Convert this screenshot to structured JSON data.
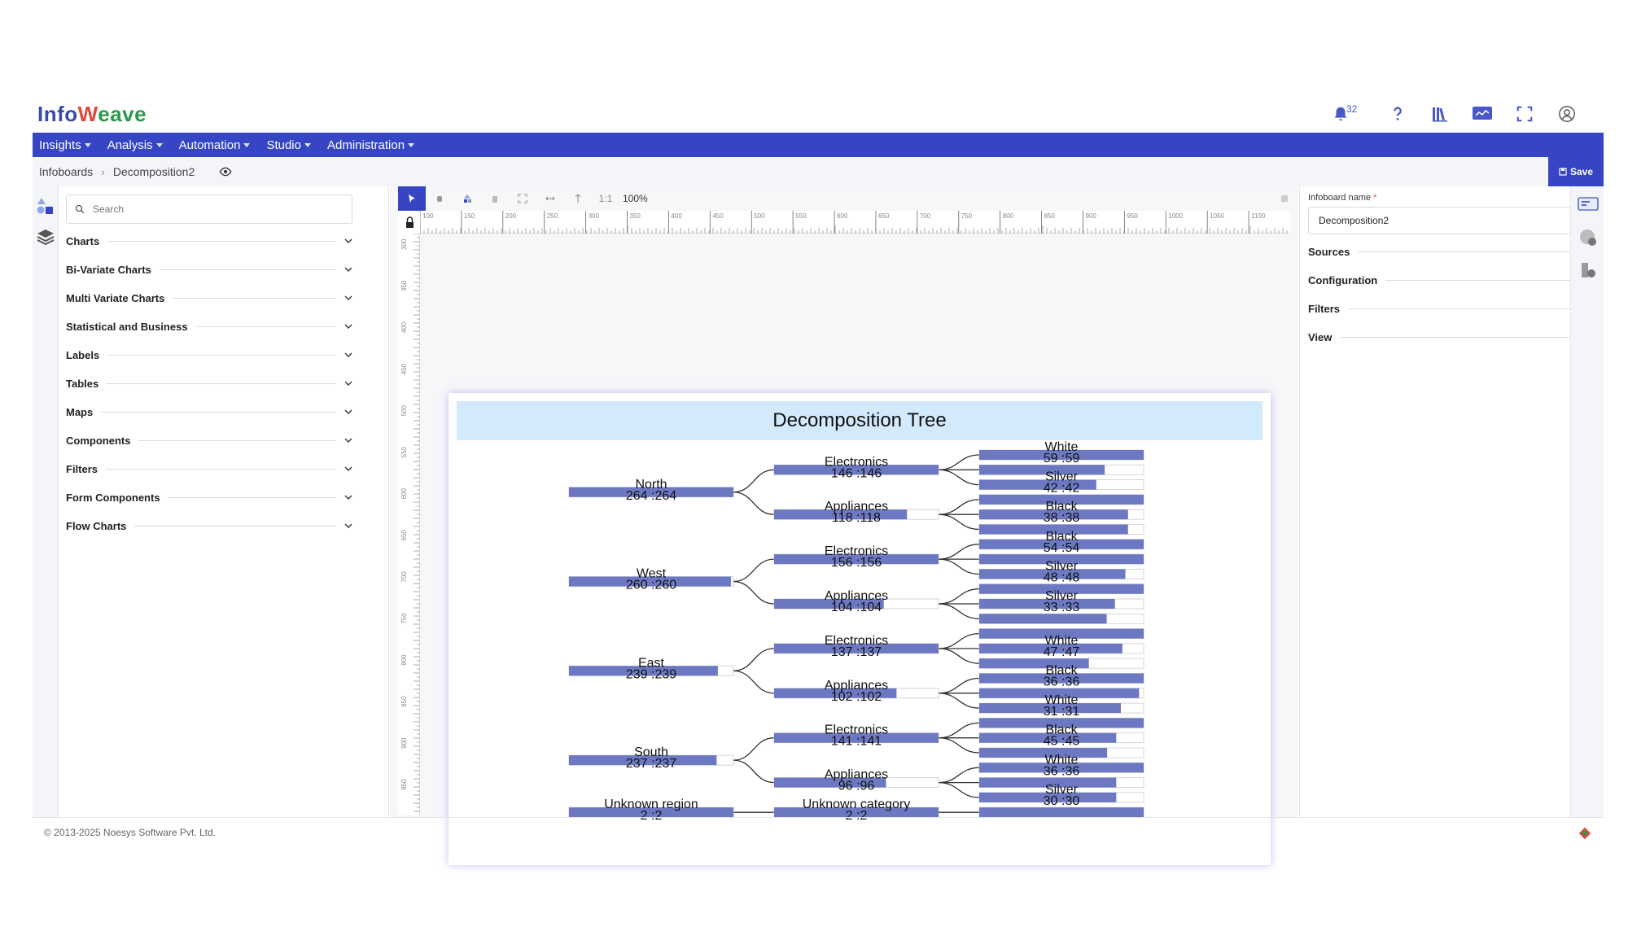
{
  "app": {
    "logo_prefix": "Info",
    "logo_suffix": "eave",
    "notification_count": "32"
  },
  "nav": [
    {
      "label": "Insights"
    },
    {
      "label": "Analysis"
    },
    {
      "label": "Automation"
    },
    {
      "label": "Studio"
    },
    {
      "label": "Administration"
    }
  ],
  "breadcrumb": {
    "root": "Infoboards",
    "current": "Decomposition2"
  },
  "toolbar": {
    "save_label": "Save",
    "zoom": "100%",
    "ratio": "1:1"
  },
  "left_panel": {
    "search_placeholder": "Search",
    "sections": [
      {
        "label": "Charts"
      },
      {
        "label": "Bi-Variate Charts"
      },
      {
        "label": "Multi Variate Charts"
      },
      {
        "label": "Statistical and Business"
      },
      {
        "label": "Labels"
      },
      {
        "label": "Tables"
      },
      {
        "label": "Maps"
      },
      {
        "label": "Components"
      },
      {
        "label": "Filters"
      },
      {
        "label": "Form Components"
      },
      {
        "label": "Flow Charts"
      }
    ]
  },
  "right_panel": {
    "name_label": "Infoboard name",
    "name_value": "Decomposition2",
    "sections": [
      {
        "label": "Sources"
      },
      {
        "label": "Configuration"
      },
      {
        "label": "Filters"
      },
      {
        "label": "View"
      }
    ]
  },
  "rulers": {
    "h_ticks": [
      "100",
      "150",
      "200",
      "250",
      "300",
      "350",
      "400",
      "450",
      "500",
      "550",
      "600",
      "650",
      "700",
      "750",
      "800",
      "850",
      "900",
      "950",
      "1000",
      "1050",
      "1100"
    ],
    "v_ticks": [
      "300",
      "350",
      "400",
      "450",
      "500",
      "550",
      "600",
      "650",
      "700",
      "750",
      "800",
      "850",
      "900",
      "950"
    ]
  },
  "chart_data": {
    "type": "decomposition-tree",
    "title": "Decomposition Tree",
    "bar_color": "#6d78c2",
    "levels": [
      {
        "nodes": [
          {
            "label": "North",
            "value": 264,
            "max": 264,
            "text": "264 :264"
          },
          {
            "label": "West",
            "value": 260,
            "max": 264,
            "text": "260 :260"
          },
          {
            "label": "East",
            "value": 239,
            "max": 264,
            "text": "239 :239"
          },
          {
            "label": "South",
            "value": 237,
            "max": 264,
            "text": "237 :237"
          },
          {
            "label": "Unknown region",
            "value": 2,
            "max": 2,
            "text": "2 :2"
          }
        ]
      },
      {
        "nodes": [
          {
            "label": "Electronics",
            "value": 146,
            "max": 146,
            "text": "146 :146",
            "parent": 0
          },
          {
            "label": "Appliances",
            "value": 118,
            "max": 146,
            "text": "118 :118",
            "parent": 0
          },
          {
            "label": "Electronics",
            "value": 156,
            "max": 156,
            "text": "156 :156",
            "parent": 1
          },
          {
            "label": "Appliances",
            "value": 104,
            "max": 156,
            "text": "104 :104",
            "parent": 1
          },
          {
            "label": "Electronics",
            "value": 137,
            "max": 137,
            "text": "137 :137",
            "parent": 2
          },
          {
            "label": "Appliances",
            "value": 102,
            "max": 137,
            "text": "102 :102",
            "parent": 2
          },
          {
            "label": "Electronics",
            "value": 141,
            "max": 141,
            "text": "141 :141",
            "parent": 3
          },
          {
            "label": "Appliances",
            "value": 96,
            "max": 141,
            "text": "96 :96",
            "parent": 3
          },
          {
            "label": "Unknown category",
            "value": 2,
            "max": 2,
            "text": "2 :2",
            "parent": 4
          }
        ]
      },
      {
        "nodes": [
          {
            "label": "White",
            "value": 59,
            "max": 59,
            "text": "59 :59",
            "parent": 0
          },
          {
            "label": "",
            "value": 45,
            "max": 59,
            "text": "",
            "parent": 0
          },
          {
            "label": "Silver",
            "value": 42,
            "max": 59,
            "text": "42 :42",
            "parent": 0
          },
          {
            "label": "",
            "value": 59,
            "max": 59,
            "text": "",
            "parent": 1
          },
          {
            "label": "Black",
            "value": 38,
            "max": 42,
            "text": "38 :38",
            "parent": 1
          },
          {
            "label": "",
            "value": 38,
            "max": 42,
            "text": "",
            "parent": 1
          },
          {
            "label": "Black",
            "value": 54,
            "max": 54,
            "text": "54 :54",
            "parent": 2
          },
          {
            "label": "",
            "value": 54,
            "max": 54,
            "text": "",
            "parent": 2
          },
          {
            "label": "Silver",
            "value": 48,
            "max": 54,
            "text": "48 :48",
            "parent": 2
          },
          {
            "label": "",
            "value": 54,
            "max": 54,
            "text": "",
            "parent": 3
          },
          {
            "label": "Silver",
            "value": 33,
            "max": 40,
            "text": "33 :33",
            "parent": 3
          },
          {
            "label": "",
            "value": 31,
            "max": 40,
            "text": "",
            "parent": 3
          },
          {
            "label": "",
            "value": 54,
            "max": 54,
            "text": "",
            "parent": 4
          },
          {
            "label": "White",
            "value": 47,
            "max": 54,
            "text": "47 :47",
            "parent": 4
          },
          {
            "label": "",
            "value": 36,
            "max": 54,
            "text": "",
            "parent": 4
          },
          {
            "label": "Black",
            "value": 36,
            "max": 36,
            "text": "36 :36",
            "parent": 5
          },
          {
            "label": "",
            "value": 35,
            "max": 36,
            "text": "",
            "parent": 5
          },
          {
            "label": "White",
            "value": 31,
            "max": 36,
            "text": "31 :31",
            "parent": 5
          },
          {
            "label": "",
            "value": 54,
            "max": 54,
            "text": "",
            "parent": 6
          },
          {
            "label": "Black",
            "value": 45,
            "max": 54,
            "text": "45 :45",
            "parent": 6
          },
          {
            "label": "",
            "value": 42,
            "max": 54,
            "text": "",
            "parent": 6
          },
          {
            "label": "White",
            "value": 36,
            "max": 36,
            "text": "36 :36",
            "parent": 7
          },
          {
            "label": "",
            "value": 30,
            "max": 36,
            "text": "",
            "parent": 7
          },
          {
            "label": "Silver",
            "value": 30,
            "max": 36,
            "text": "30 :30",
            "parent": 7
          },
          {
            "label": "",
            "value": 2,
            "max": 2,
            "text": "",
            "parent": 8
          }
        ]
      }
    ]
  },
  "footer": {
    "copyright": "© 2013-2025 Noesys Software Pvt. Ltd."
  }
}
